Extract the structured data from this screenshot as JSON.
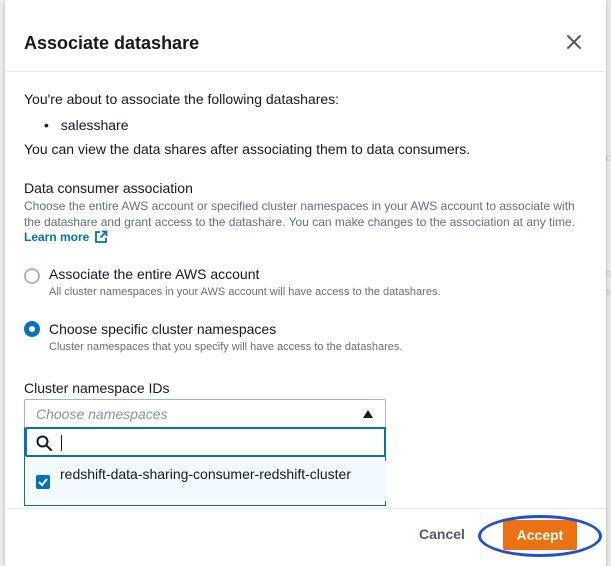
{
  "backdrop": {
    "frag1": "lic",
    "frag2": "ss",
    "frag3": "lis"
  },
  "modal": {
    "title": "Associate datashare",
    "intro": "You're about to associate the following datashares:",
    "datashares": [
      "salesshare"
    ],
    "view_note": "You can view the data shares after associating them to data consumers.",
    "consumer_section": {
      "label": "Data consumer association",
      "description_line1": "Choose the entire AWS account or specified cluster namespaces in your AWS account to associate with",
      "description_line2": "the datashare and grant access to the datashare. You can make changes to the association at any time.",
      "learn_more": "Learn more"
    },
    "options": [
      {
        "label": "Associate the entire AWS account",
        "description": "All cluster namespaces in your AWS account will have access to the datashares.",
        "selected": false
      },
      {
        "label": "Choose specific cluster namespaces",
        "description": "Cluster namespaces that you specify will have access to the datashares.",
        "selected": true
      }
    ],
    "namespace": {
      "label": "Cluster namespace IDs",
      "placeholder": "Choose namespaces",
      "search_value": "",
      "items": [
        {
          "label": "redshift-data-sharing-consumer-redshift-cluster",
          "checked": true
        }
      ]
    },
    "footer": {
      "cancel": "Cancel",
      "accept": "Accept"
    }
  },
  "colors": {
    "accent": "#0073bb",
    "primary_button": "#ec7211",
    "annotation": "#1a4fe0"
  },
  "icons": {
    "close": "close-icon",
    "external": "external-link-icon",
    "search": "search-icon",
    "caret": "caret-up-icon",
    "check": "checkmark-icon"
  }
}
